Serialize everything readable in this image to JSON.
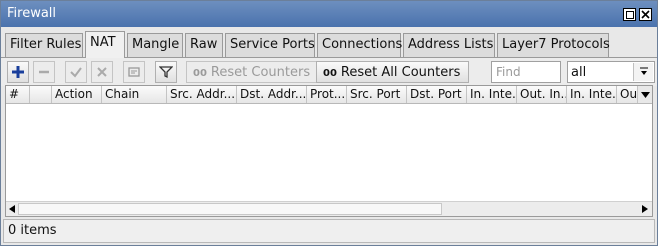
{
  "window": {
    "title": "Firewall"
  },
  "tabs": [
    "Filter Rules",
    "NAT",
    "Mangle",
    "Raw",
    "Service Ports",
    "Connections",
    "Address Lists",
    "Layer7 Protocols"
  ],
  "active_tab": "NAT",
  "toolbar": {
    "add_icon": "plus-icon",
    "remove_icon": "minus-icon",
    "enable_icon": "check-icon",
    "disable_icon": "x-icon",
    "comment_icon": "note-icon",
    "filter_icon": "funnel-icon",
    "counter_glyph": "00",
    "reset_counters_label": "Reset Counters",
    "reset_all_counters_label": "Reset All Counters",
    "find_placeholder": "Find",
    "filter_value": "all"
  },
  "table": {
    "columns": [
      "#",
      "",
      "Action",
      "Chain",
      "Src. Addr...",
      "Dst. Addr...",
      "Prot...",
      "Src. Port",
      "Dst. Port",
      "In. Inte...",
      "Out. In...",
      "In. Inte...",
      "Ou"
    ],
    "rows": []
  },
  "status": {
    "items_text": "0 items"
  },
  "colors": {
    "titlebar": "#5a80b6",
    "add_icon": "#1a3f9c"
  }
}
